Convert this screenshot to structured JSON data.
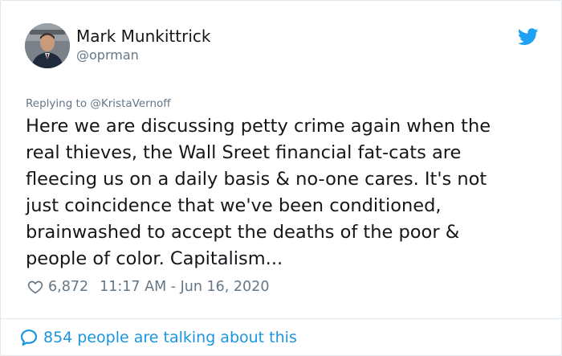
{
  "author": {
    "display_name": "Mark Munkittrick",
    "handle": "@oprman",
    "avatar_icon": "profile-photo"
  },
  "brand": {
    "icon": "twitter-bird-icon",
    "color": "#1da1f2"
  },
  "tweet": {
    "reply_to": "Replying to @KristaVernoff",
    "text_lines": [
      "Here we are discussing petty crime again when the",
      "real thieves, the Wall Sreet financial fat-cats are",
      "fleecing us on a daily basis & no-one cares. It's not",
      "just coincidence that we've been conditioned,",
      "brainwashed to accept the deaths of the poor &",
      "people of color. Capitalism..."
    ],
    "likes": "6,872",
    "timestamp": "11:17 AM - Jun 16, 2020"
  },
  "footer": {
    "conversation_text": "854 people are talking about this",
    "link_color": "#1b95e0"
  }
}
